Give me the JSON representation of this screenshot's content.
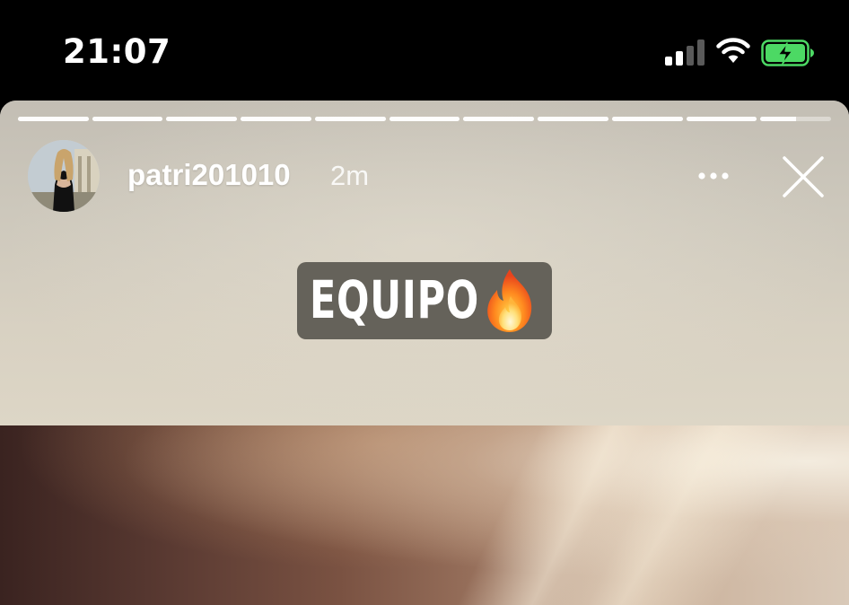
{
  "status_bar": {
    "time": "21:07",
    "signal_icon": "cellular-signal-icon",
    "signal_bars_active": 2,
    "signal_bars_total": 4,
    "wifi_icon": "wifi-icon",
    "battery_icon": "battery-charging-icon",
    "battery_color": "#4cd964"
  },
  "story": {
    "progress_segments_total": 11,
    "progress_segments_complete": 10,
    "current_segment_progress": 0.5,
    "username": "patri201010",
    "posted_ago": "2m",
    "more_icon": "more-horizontal-icon",
    "close_icon": "close-icon",
    "sticker": {
      "text": "EQUIPO",
      "emoji_icon": "fire-icon"
    }
  }
}
